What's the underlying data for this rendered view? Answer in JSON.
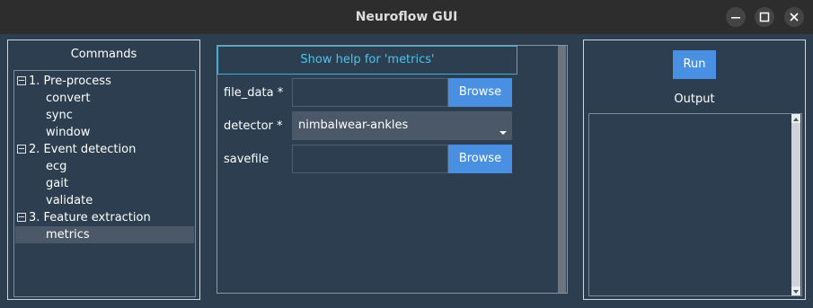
{
  "window": {
    "title": "Neuroflow GUI"
  },
  "commands": {
    "header": "Commands",
    "groups": [
      {
        "label": "1. Pre-process",
        "items": [
          "convert",
          "sync",
          "window"
        ]
      },
      {
        "label": "2. Event detection",
        "items": [
          "ecg",
          "gait",
          "validate"
        ]
      },
      {
        "label": "3. Feature extraction",
        "items": [
          "metrics"
        ]
      }
    ],
    "selected": "metrics"
  },
  "form": {
    "help_label": "Show help for 'metrics'",
    "fields": [
      {
        "label": "file_data *",
        "value": "",
        "button": "Browse"
      },
      {
        "label": "detector *",
        "selected": "nimbalwear-ankles"
      },
      {
        "label": "savefile",
        "value": "",
        "button": "Browse"
      }
    ]
  },
  "run": {
    "button": "Run",
    "output_label": "Output"
  },
  "colors": {
    "accent": "#4a90e2",
    "help_text": "#4cc4ea",
    "panel_bg": "#2c3e50"
  },
  "icons": [
    "minimize-icon",
    "maximize-icon",
    "close-icon",
    "collapse-icon",
    "dropdown-caret-icon",
    "scroll-up-icon",
    "scroll-down-icon"
  ]
}
